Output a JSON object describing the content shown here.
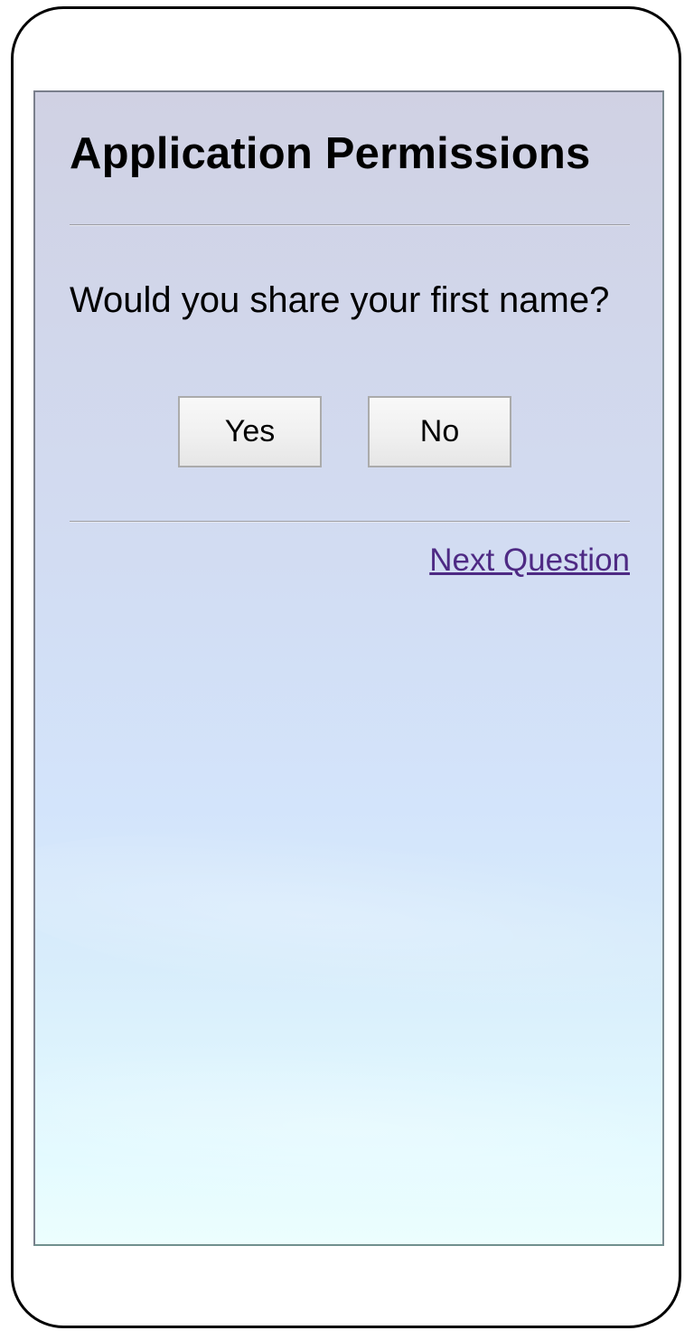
{
  "page": {
    "title": "Application Permissions",
    "question": "Would you share your first name?",
    "buttons": {
      "yes_label": "Yes",
      "no_label": "No"
    },
    "next_link": "Next Question"
  },
  "colors": {
    "link": "#4e2a84",
    "screen_gradient_top": "#d0d1e3",
    "screen_gradient_bottom": "#ecfefe",
    "device_border": "#000000"
  }
}
